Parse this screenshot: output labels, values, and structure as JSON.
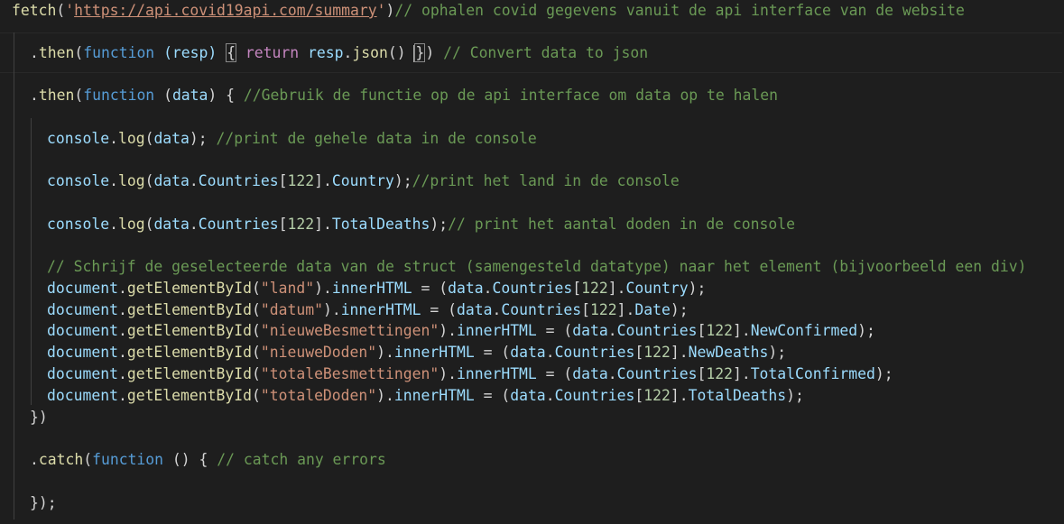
{
  "editor": {
    "theme_colors": {
      "background": "#1e1e1e",
      "function": "#dcdcaa",
      "property": "#9cdcfe",
      "keyword": "#569cd6",
      "control": "#c586c0",
      "string": "#ce9178",
      "comment": "#6a9955",
      "number": "#b5cea8",
      "plain": "#d4d4d4"
    },
    "code": {
      "l1": {
        "fetch": "fetch",
        "open": "(",
        "q1": "'",
        "url": "https://api.covid19api.com/summary",
        "q2": "'",
        "close": ")",
        "comment": "// ophalen covid gegevens vanuit de api interface van de website"
      },
      "l2": {
        "dot": ".",
        "then": "then",
        "open": "(",
        "function_kw": "function",
        "sp": " ",
        "params": "(resp)",
        "sp2": " ",
        "brace_open": "{",
        "sp3": " ",
        "return_kw": "return",
        "sp4": " ",
        "resp": "resp",
        "dot2": ".",
        "json": "json",
        "call": "()",
        "sp5": " ",
        "brace_close": "}",
        "close": ")",
        "sp6": " ",
        "comment": "// Convert data to json"
      },
      "l3": {
        "dot": ".",
        "then": "then",
        "open": "(",
        "function_kw": "function",
        "sp": " ",
        "p_open": "(",
        "data": "data",
        "p_close": ")",
        "tail": " { ",
        "comment": "//Gebruik de functie op de api interface om data op te halen"
      },
      "l4": {
        "console": "console",
        "dot": ".",
        "log": "log",
        "open": "(",
        "data": "data",
        "close": ");",
        "sp": " ",
        "comment": "//print de gehele data in de console"
      },
      "l5": {
        "console": "console",
        "dot": ".",
        "log": "log",
        "open": "(",
        "data": "data",
        "dot2": ".",
        "countries": "Countries",
        "br_open": "[",
        "index": "122",
        "br_close": "]",
        "dot3": ".",
        "country": "Country",
        "close": ");",
        "comment": "//print het land in de console"
      },
      "l6": {
        "console": "console",
        "dot": ".",
        "log": "log",
        "open": "(",
        "data": "data",
        "dot2": ".",
        "countries": "Countries",
        "br_open": "[",
        "index": "122",
        "br_close": "]",
        "dot3": ".",
        "prop": "TotalDeaths",
        "close": ");",
        "comment": "// print het aantal doden in de console"
      },
      "l7": {
        "comment": "// Schrijf de geselecteerde data van de struct (samengesteld datatype) naar het element (bijvoorbeeld een div)"
      },
      "l8": {
        "document": "document",
        "dot": ".",
        "get": "getElementById",
        "open": "(",
        "id": "\"land\"",
        "close": ")",
        "dot2": ".",
        "inner": "innerHTML",
        "eq": " = (",
        "data": "data",
        "dot3": ".",
        "countries": "Countries",
        "br_open": "[",
        "index": "122",
        "br_close": "]",
        "dot4": ".",
        "prop": "Country",
        "end": ");"
      },
      "l9": {
        "document": "document",
        "dot": ".",
        "get": "getElementById",
        "open": "(",
        "id": "\"datum\"",
        "close": ")",
        "dot2": ".",
        "inner": "innerHTML",
        "eq": " = (",
        "data": "data",
        "dot3": ".",
        "countries": "Countries",
        "br_open": "[",
        "index": "122",
        "br_close": "]",
        "dot4": ".",
        "prop": "Date",
        "end": ");"
      },
      "l10": {
        "document": "document",
        "dot": ".",
        "get": "getElementById",
        "open": "(",
        "id": "\"nieuweBesmettingen\"",
        "close": ")",
        "dot2": ".",
        "inner": "innerHTML",
        "eq": " = (",
        "data": "data",
        "dot3": ".",
        "countries": "Countries",
        "br_open": "[",
        "index": "122",
        "br_close": "]",
        "dot4": ".",
        "prop": "NewConfirmed",
        "end": ");"
      },
      "l11": {
        "document": "document",
        "dot": ".",
        "get": "getElementById",
        "open": "(",
        "id": "\"nieuweDoden\"",
        "close": ")",
        "dot2": ".",
        "inner": "innerHTML",
        "eq": " = (",
        "data": "data",
        "dot3": ".",
        "countries": "Countries",
        "br_open": "[",
        "index": "122",
        "br_close": "]",
        "dot4": ".",
        "prop": "NewDeaths",
        "end": ");"
      },
      "l12": {
        "document": "document",
        "dot": ".",
        "get": "getElementById",
        "open": "(",
        "id": "\"totaleBesmettingen\"",
        "close": ")",
        "dot2": ".",
        "inner": "innerHTML",
        "eq": " = (",
        "data": "data",
        "dot3": ".",
        "countries": "Countries",
        "br_open": "[",
        "index": "122",
        "br_close": "]",
        "dot4": ".",
        "prop": "TotalConfirmed",
        "end": ");"
      },
      "l13": {
        "document": "document",
        "dot": ".",
        "get": "getElementById",
        "open": "(",
        "id": "\"totaleDoden\"",
        "close": ")",
        "dot2": ".",
        "inner": "innerHTML",
        "eq": " = (",
        "data": "data",
        "dot3": ".",
        "countries": "Countries",
        "br_open": "[",
        "index": "122",
        "br_close": "]",
        "dot4": ".",
        "prop": "TotalDeaths",
        "end": ");"
      },
      "l14": {
        "text": "})"
      },
      "l15": {
        "dot": ".",
        "catch": "catch",
        "open": "(",
        "function_kw": "function",
        "tail": " () { ",
        "comment": "// catch any errors"
      },
      "l16": {
        "text": "});"
      }
    }
  }
}
